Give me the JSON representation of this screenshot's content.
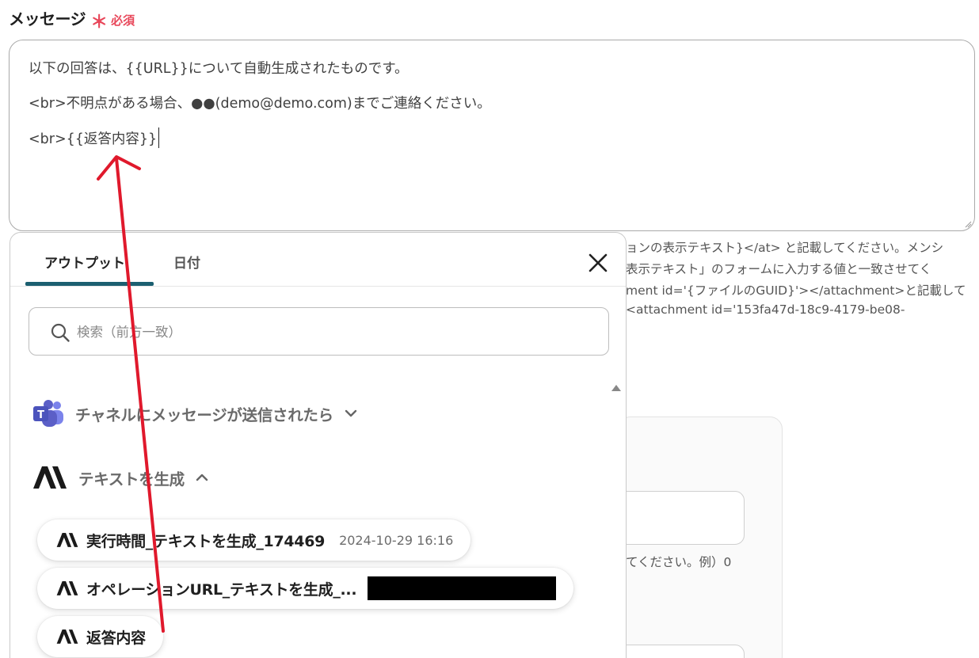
{
  "field": {
    "label": "メッセージ",
    "required_mark": "＊",
    "required_text": "必須"
  },
  "message": {
    "lines": [
      "以下の回答は、{{URL}}について自動生成されたものです。",
      "<br>不明点がある場合、●●(demo@demo.com)までご連絡ください。",
      "<br>{{返答内容}}"
    ]
  },
  "help_text": [
    "ョンの表示テキスト}</at> と記載してください。メンシ",
    "表示テキスト」のフォームに入力する値と一致させてく",
    "ment id='{ファイルのGUID}'></attachment>と記載して",
    " <attachment id='153fa47d-18c9-4179-be08-"
  ],
  "background_hint": "てください。例）0",
  "panel": {
    "tabs": [
      {
        "label": "アウトプット",
        "active": true
      },
      {
        "label": "日付",
        "active": false
      }
    ],
    "search_placeholder": "検索（前方一致）",
    "sections": [
      {
        "title": "チャネルにメッセージが送信されたら",
        "icon": "teams-icon",
        "expanded": false
      },
      {
        "title": "テキストを生成",
        "icon": "anthropic-icon",
        "expanded": true
      }
    ],
    "items": [
      {
        "name": "実行時間_テキストを生成_174469",
        "value": "2024-10-29 16:16",
        "redacted": false
      },
      {
        "name": "オペレーションURL_テキストを生成_...",
        "value": "",
        "redacted": true
      },
      {
        "name": "返答内容",
        "value": "",
        "redacted": false
      }
    ]
  },
  "colors": {
    "required": "#e8475a",
    "tab_underline": "#1b5f70",
    "arrow": "#e0192c",
    "teams": "#5b5fc7"
  }
}
